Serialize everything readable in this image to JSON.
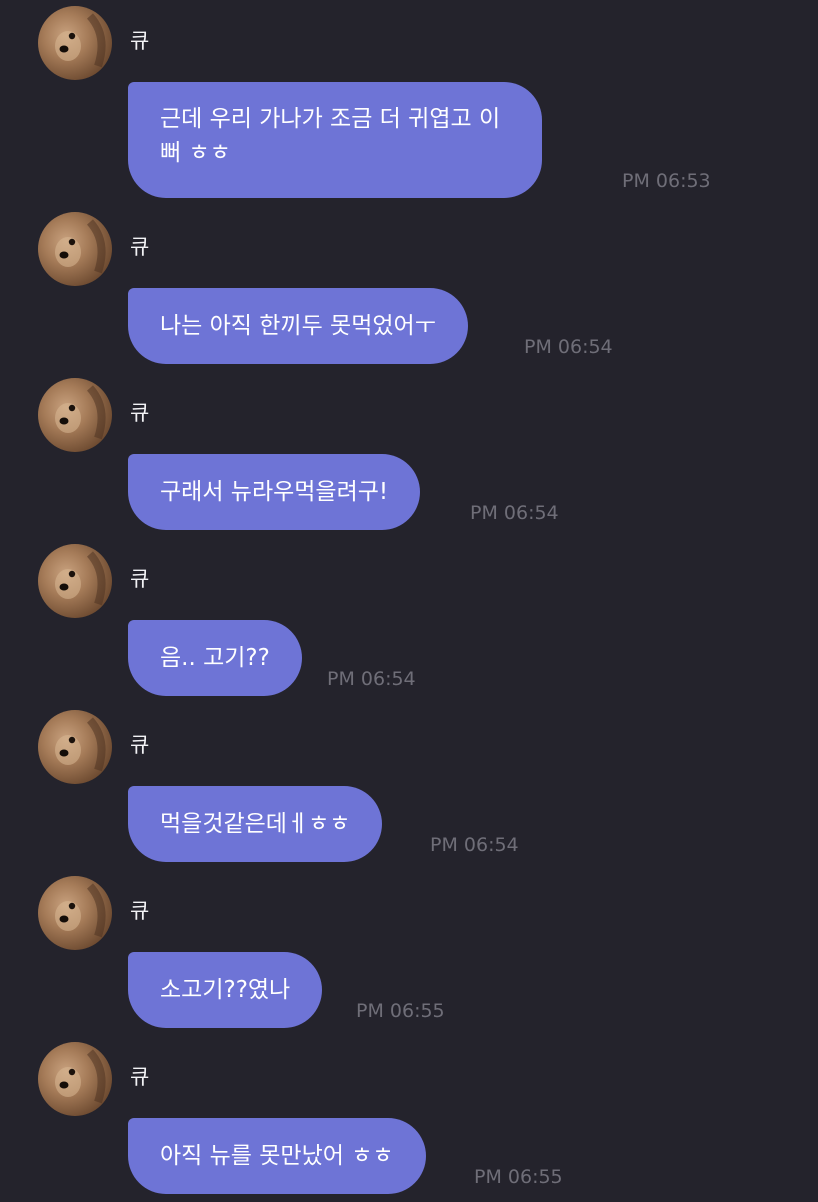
{
  "contact": {
    "name": "큐",
    "avatar_icon": "dog-avatar-icon"
  },
  "messages": [
    {
      "text": "근데 우리 가나가 조금 더 귀엽고 이뻐 ㅎㅎ",
      "time": "PM 06:53"
    },
    {
      "text": "나는 아직 한끼두 못먹었어ㅜ",
      "time": "PM 06:54"
    },
    {
      "text": "구래서 뉴라우먹을려구!",
      "time": "PM 06:54"
    },
    {
      "text": "음.. 고기??",
      "time": "PM 06:54"
    },
    {
      "text": "먹을것같은데ㅔㅎㅎ",
      "time": "PM 06:54"
    },
    {
      "text": "소고기??였나",
      "time": "PM 06:55"
    },
    {
      "text": "아직 뉴를 못만났어 ㅎㅎ",
      "time": "PM 06:55"
    }
  ],
  "colors": {
    "background": "#24232c",
    "bubble": "#6e74d6",
    "timestamp": "#6f6e78"
  }
}
